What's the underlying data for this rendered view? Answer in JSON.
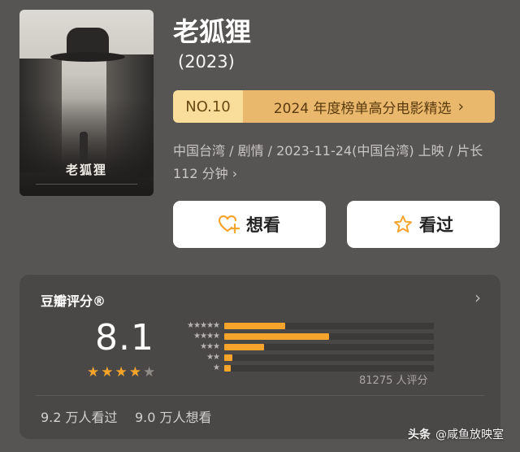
{
  "movie": {
    "title": "老狐狸",
    "year": "(2023)",
    "poster_title": "老狐狸"
  },
  "ranking": {
    "number": "NO.10",
    "label": "2024 年度榜单高分电影精选",
    "chevron": "›"
  },
  "meta": {
    "line": "中国台湾 / 剧情 / 2023-11-24(中国台湾) 上映 / 片长 112 分钟",
    "chevron": "›"
  },
  "actions": {
    "want_label": "想看",
    "seen_label": "看过",
    "want_icon": "heart-plus-icon",
    "seen_icon": "star-outline-icon"
  },
  "rating": {
    "title": "豆瓣评分®",
    "chevron": "›",
    "score": "8.1",
    "stars_filled": 4,
    "stars_total": 5,
    "distribution": [
      {
        "stars": 5,
        "fraction": 0.29
      },
      {
        "stars": 4,
        "fraction": 0.5
      },
      {
        "stars": 3,
        "fraction": 0.19
      },
      {
        "stars": 2,
        "fraction": 0.04
      },
      {
        "stars": 1,
        "fraction": 0.03
      }
    ],
    "rating_count": "81275 人评分",
    "seen_count": "9.2 万人看过",
    "want_count": "9.0 万人想看",
    "accent_color": "#f7a42c"
  },
  "watermark": {
    "brand": "头条",
    "account": "@咸鱼放映室"
  }
}
